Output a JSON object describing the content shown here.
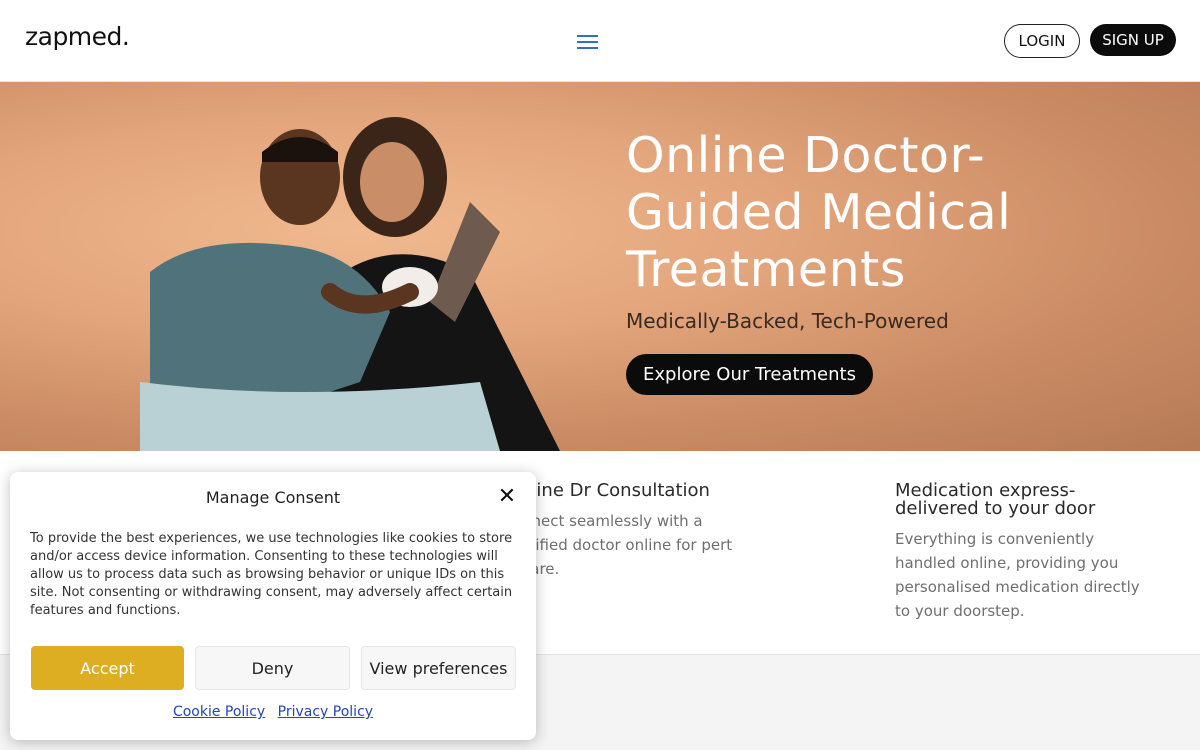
{
  "header": {
    "logo": "zapmed.",
    "login_label": "LOGIN",
    "signup_label": "SIGN UP"
  },
  "hero": {
    "title": "Online Doctor-Guided Medical Treatments",
    "subtitle": "Medically-Backed, Tech-Powered",
    "cta_label": "Explore Our Treatments"
  },
  "features": [
    {
      "title": "nline Dr Consultation",
      "text": "nnect seamlessly with a alified doctor online for pert care."
    },
    {
      "title": "Medication express-delivered to your door",
      "text": "Everything is conveniently handled online, providing you personalised medication directly to your doorstep."
    }
  ],
  "consent": {
    "title": "Manage Consent",
    "body": "To provide the best experiences, we use technologies like cookies to store and/or access device information. Consenting to these technologies will allow us to process data such as browsing behavior or unique IDs on this site. Not consenting or withdrawing consent, may adversely affect certain features and functions.",
    "accept_label": "Accept",
    "deny_label": "Deny",
    "preferences_label": "View preferences",
    "cookie_policy_label": "Cookie Policy",
    "privacy_policy_label": "Privacy Policy"
  },
  "colors": {
    "accent": "#deae22",
    "menu_icon": "#2d6fd2",
    "link": "#2246b8"
  }
}
